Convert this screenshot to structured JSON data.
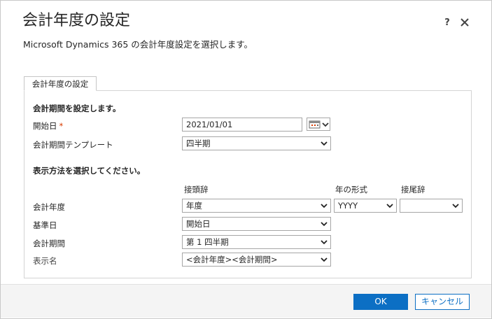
{
  "dialog": {
    "title": "会計年度の設定",
    "subtitle": "Microsoft Dynamics 365 の会計年度設定を選択します。",
    "help_label": "?"
  },
  "tab": {
    "label": "会計年度の設定"
  },
  "section_period": {
    "heading": "会計期間を設定します。",
    "start_date_label": "開始日",
    "required_mark": "*",
    "start_date_value": "2021/01/01",
    "template_label": "会計期間テンプレート",
    "template_value": "四半期"
  },
  "section_display": {
    "heading": "表示方法を選択してください。",
    "col_prefix": "接頭辞",
    "col_year_format": "年の形式",
    "col_suffix": "接尾辞",
    "fiscal_year_label": "会計年度",
    "fiscal_year_prefix": "年度",
    "fiscal_year_format": "YYYY",
    "fiscal_year_suffix": "",
    "base_date_label": "基準日",
    "base_date_value": "開始日",
    "fiscal_period_label": "会計期間",
    "fiscal_period_value": "第 1 四半期",
    "display_name_label": "表示名",
    "display_name_value": "<会計年度><会計期間>"
  },
  "footer": {
    "ok_label": "OK",
    "cancel_label": "キャンセル"
  },
  "colors": {
    "accent": "#0c6fc4",
    "required": "#d83b01"
  }
}
